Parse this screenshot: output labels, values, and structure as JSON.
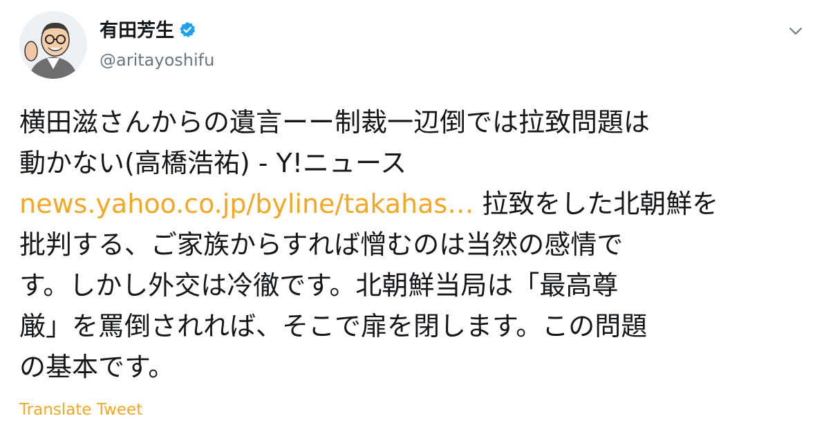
{
  "author": {
    "display_name": "有田芳生",
    "handle": "@aritayoshifu",
    "verified": true,
    "avatar": "avatar-illustration"
  },
  "colors": {
    "link": "#f5a623",
    "verified_badge": "#1da1f2",
    "text": "#14171a",
    "muted": "#657786"
  },
  "menu": {
    "icon": "chevron-down-icon"
  },
  "tweet": {
    "line1": "横田滋さんからの遺言ーー制裁一辺倒では拉致問題は",
    "line2": "動かない(高橋浩祐) - Y!ニュース",
    "link_text": "news.yahoo.co.jp/byline/takahas…",
    "line3_rest": " 拉致をした北朝鮮を",
    "line4": "批判する、ご家族からすれば憎むのは当然の感情で",
    "line5": "す。しかし外交は冷徹です。北朝鮮当局は「最高尊",
    "line6": "厳」を罵倒されれば、そこで扉を閉します。この問題",
    "line7": "の基本です。"
  },
  "actions": {
    "translate_label": "Translate Tweet"
  }
}
